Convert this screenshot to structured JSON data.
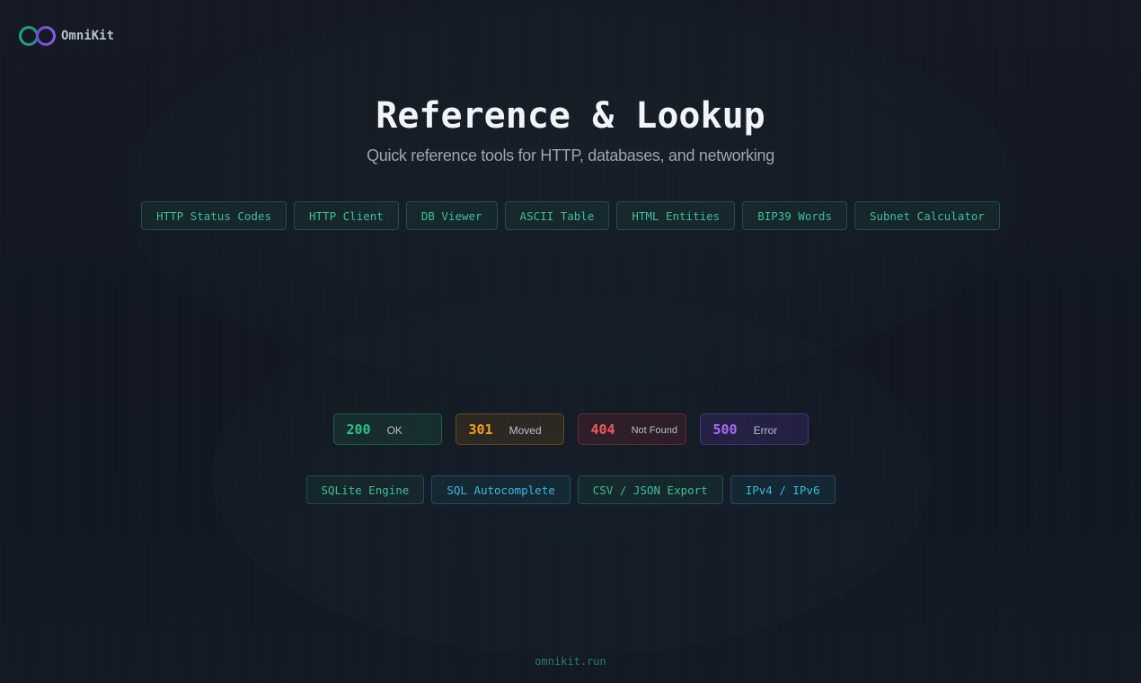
{
  "brand": {
    "name": "OmniKit",
    "accent_teal": "#1fa38a",
    "accent_purple": "#7c4dd8"
  },
  "header": {
    "title": "Reference & Lookup",
    "subtitle": "Quick reference tools for HTTP, databases, and networking"
  },
  "tools": [
    {
      "label": "HTTP Status Codes"
    },
    {
      "label": "HTTP Client"
    },
    {
      "label": "DB Viewer"
    },
    {
      "label": "ASCII Table"
    },
    {
      "label": "HTML Entities"
    },
    {
      "label": "BIP39 Words"
    },
    {
      "label": "Subnet Calculator"
    }
  ],
  "status_codes": [
    {
      "code": "200",
      "label": "OK",
      "color": "#2fc08a"
    },
    {
      "code": "301",
      "label": "Moved",
      "color": "#f0a022"
    },
    {
      "code": "404",
      "label": "Not Found",
      "color": "#f05a5e"
    },
    {
      "code": "500",
      "label": "Error",
      "color": "#a56cf5"
    }
  ],
  "features": [
    {
      "label": "SQLite Engine",
      "color": "#3fbf96"
    },
    {
      "label": "SQL Autocomplete",
      "color": "#3cb8dc"
    },
    {
      "label": "CSV / JSON Export",
      "color": "#3fbf96"
    },
    {
      "label": "IPv4 / IPv6",
      "color": "#3cb8dc"
    }
  ],
  "footer": {
    "text": "omnikit.run"
  },
  "icons": {
    "logo": "infinity-rings-icon"
  }
}
